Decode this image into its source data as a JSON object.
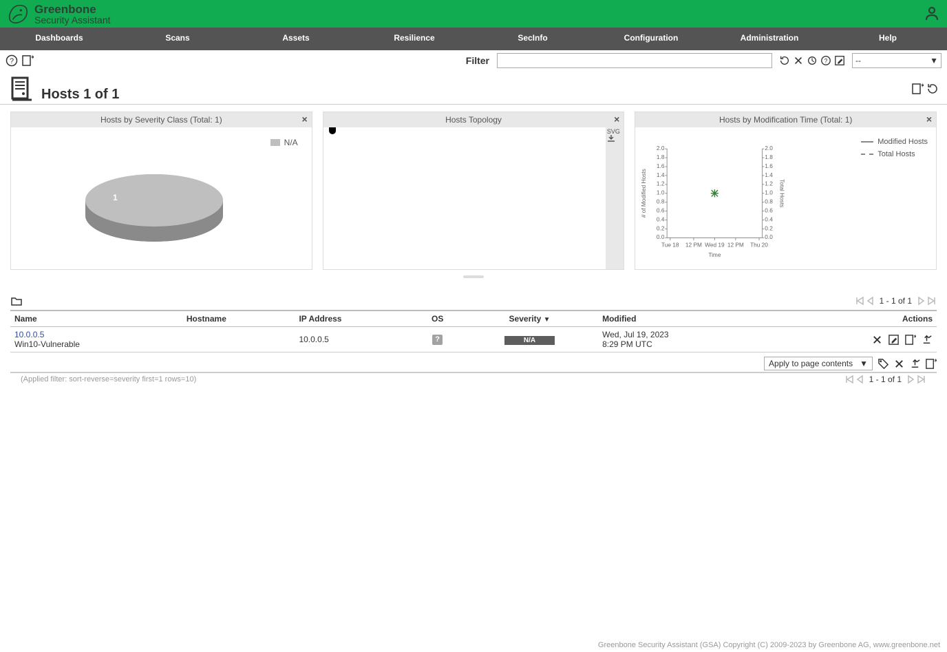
{
  "header": {
    "brand_title": "Greenbone",
    "brand_sub": "Security Assistant"
  },
  "nav": [
    "Dashboards",
    "Scans",
    "Assets",
    "Resilience",
    "SecInfo",
    "Configuration",
    "Administration",
    "Help"
  ],
  "filter": {
    "label": "Filter",
    "value": "",
    "select_value": "--"
  },
  "page": {
    "title": "Hosts 1 of 1"
  },
  "cards": {
    "severity": {
      "title": "Hosts by Severity Class (Total: 1)",
      "legend_na": "N/A",
      "slice_label": "1"
    },
    "topology": {
      "title": "Hosts Topology",
      "svg_btn": "SVG"
    },
    "modification": {
      "title": "Hosts by Modification Time (Total: 1)",
      "legend_modified": "Modified Hosts",
      "legend_total": "Total Hosts",
      "y_label": "# of Modified Hosts",
      "y2_label": "Total Hosts",
      "x_label": "Time"
    }
  },
  "chart_data": {
    "type": "scatter",
    "title": "Hosts by Modification Time (Total: 1)",
    "x_ticks": [
      "Tue 18",
      "12 PM",
      "Wed 19",
      "12 PM",
      "Thu 20"
    ],
    "y_ticks": [
      "0.0",
      "0.2",
      "0.4",
      "0.6",
      "0.8",
      "1.0",
      "1.2",
      "1.4",
      "1.6",
      "1.8",
      "2.0"
    ],
    "y2_ticks": [
      "0.0",
      "0.2",
      "0.4",
      "0.6",
      "0.8",
      "1.0",
      "1.2",
      "1.4",
      "1.6",
      "1.8",
      "2.0"
    ],
    "series": [
      {
        "name": "Modified Hosts",
        "style": "solid",
        "points": [
          {
            "x": "Wed 19",
            "y": 1.0
          }
        ]
      },
      {
        "name": "Total Hosts",
        "style": "dashed",
        "points": [
          {
            "x": "Wed 19",
            "y": 1.0
          }
        ]
      }
    ],
    "xlabel": "Time",
    "ylabel": "# of Modified Hosts",
    "y2label": "Total Hosts",
    "ylim": [
      0,
      2
    ]
  },
  "pager": {
    "text": "1 - 1 of 1"
  },
  "table": {
    "columns": {
      "name": "Name",
      "hostname": "Hostname",
      "ip": "IP Address",
      "os": "OS",
      "severity": "Severity",
      "modified": "Modified",
      "actions": "Actions"
    },
    "sort_indicator": "▼",
    "rows": [
      {
        "name": "10.0.0.5",
        "hostname": "Win10-Vulnerable",
        "ip": "10.0.0.5",
        "os": "?",
        "severity": "N/A",
        "modified_line1": "Wed, Jul 19, 2023",
        "modified_line2": "8:29 PM UTC"
      }
    ]
  },
  "footer_actions": {
    "apply_label": "Apply to page contents"
  },
  "applied_filter": "(Applied filter: sort-reverse=severity first=1 rows=10)",
  "page_footer": "Greenbone Security Assistant (GSA) Copyright (C) 2009-2023 by Greenbone AG, www.greenbone.net"
}
